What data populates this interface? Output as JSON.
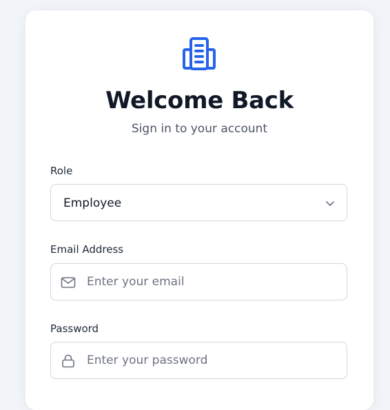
{
  "header": {
    "logo_icon": "building-icon",
    "title": "Welcome Back",
    "subtitle": "Sign in to your account"
  },
  "form": {
    "role": {
      "label": "Role",
      "selected": "Employee",
      "icon": "chevron-down-icon"
    },
    "email": {
      "label": "Email Address",
      "value": "",
      "placeholder": "Enter your email",
      "icon": "mail-icon"
    },
    "password": {
      "label": "Password",
      "value": "",
      "placeholder": "Enter your password",
      "icon": "lock-icon"
    }
  },
  "colors": {
    "accent": "#2563eb",
    "background": "#f1f4f8",
    "card": "#ffffff",
    "border": "#d1d5db",
    "title": "#111827",
    "muted": "#4b5563",
    "placeholder": "#6b7280"
  }
}
